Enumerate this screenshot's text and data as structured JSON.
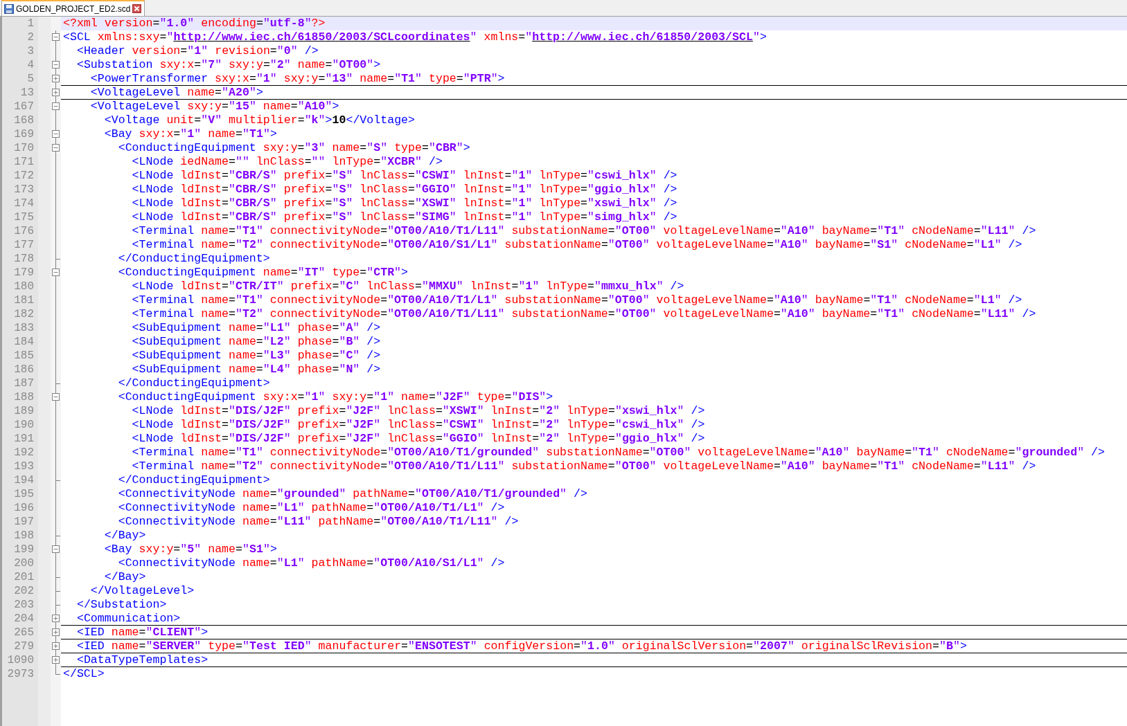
{
  "tab": {
    "title": "GOLDEN_PROJECT_ED2.scd",
    "selected": true
  },
  "lines": [
    {
      "number": "1",
      "kind": "plain",
      "current": true,
      "code": "<?xml version=\"1.0\" encoding=\"utf-8\"?>"
    },
    {
      "number": "2",
      "kind": "fold-open",
      "current": false,
      "code": "<SCL xmlns:sxy=\"http://www.iec.ch/61850/2003/SCLcoordinates\" xmlns=\"http://www.iec.ch/61850/2003/SCL\">"
    },
    {
      "number": "3",
      "kind": "plain",
      "current": false,
      "code": "  <Header version=\"1\" revision=\"0\" />"
    },
    {
      "number": "4",
      "kind": "fold-open",
      "current": false,
      "code": "  <Substation sxy:x=\"7\" sxy:y=\"2\" name=\"OT00\">"
    },
    {
      "number": "5",
      "kind": "fold-closed",
      "current": false,
      "code": "    <PowerTransformer sxy:x=\"1\" sxy:y=\"13\" name=\"T1\" type=\"PTR\">"
    },
    {
      "number": "13",
      "kind": "fold-closed",
      "current": false,
      "code": "    <VoltageLevel name=\"A20\">"
    },
    {
      "number": "167",
      "kind": "fold-open",
      "current": false,
      "code": "    <VoltageLevel sxy:y=\"15\" name=\"A10\">"
    },
    {
      "number": "168",
      "kind": "plain",
      "current": false,
      "code": "      <Voltage unit=\"V\" multiplier=\"k\">10</Voltage>"
    },
    {
      "number": "169",
      "kind": "fold-open",
      "current": false,
      "code": "      <Bay sxy:x=\"1\" name=\"T1\">"
    },
    {
      "number": "170",
      "kind": "fold-open",
      "current": false,
      "code": "        <ConductingEquipment sxy:y=\"3\" name=\"S\" type=\"CBR\">"
    },
    {
      "number": "171",
      "kind": "plain",
      "current": false,
      "code": "          <LNode iedName=\"\" lnClass=\"\" lnType=\"XCBR\" />"
    },
    {
      "number": "172",
      "kind": "plain",
      "current": false,
      "code": "          <LNode ldInst=\"CBR/S\" prefix=\"S\" lnClass=\"CSWI\" lnInst=\"1\" lnType=\"cswi_hlx\" />"
    },
    {
      "number": "173",
      "kind": "plain",
      "current": false,
      "code": "          <LNode ldInst=\"CBR/S\" prefix=\"S\" lnClass=\"GGIO\" lnInst=\"1\" lnType=\"ggio_hlx\" />"
    },
    {
      "number": "174",
      "kind": "plain",
      "current": false,
      "code": "          <LNode ldInst=\"CBR/S\" prefix=\"S\" lnClass=\"XSWI\" lnInst=\"1\" lnType=\"xswi_hlx\" />"
    },
    {
      "number": "175",
      "kind": "plain",
      "current": false,
      "code": "          <LNode ldInst=\"CBR/S\" prefix=\"S\" lnClass=\"SIMG\" lnInst=\"1\" lnType=\"simg_hlx\" />"
    },
    {
      "number": "176",
      "kind": "plain",
      "current": false,
      "code": "          <Terminal name=\"T1\" connectivityNode=\"OT00/A10/T1/L11\" substationName=\"OT00\" voltageLevelName=\"A10\" bayName=\"T1\" cNodeName=\"L11\" />"
    },
    {
      "number": "177",
      "kind": "plain",
      "current": false,
      "code": "          <Terminal name=\"T2\" connectivityNode=\"OT00/A10/S1/L1\" substationName=\"OT00\" voltageLevelName=\"A10\" bayName=\"S1\" cNodeName=\"L1\" />"
    },
    {
      "number": "178",
      "kind": "fold-end",
      "current": false,
      "code": "        </ConductingEquipment>"
    },
    {
      "number": "179",
      "kind": "fold-open",
      "current": false,
      "code": "        <ConductingEquipment name=\"IT\" type=\"CTR\">"
    },
    {
      "number": "180",
      "kind": "plain",
      "current": false,
      "code": "          <LNode ldInst=\"CTR/IT\" prefix=\"C\" lnClass=\"MMXU\" lnInst=\"1\" lnType=\"mmxu_hlx\" />"
    },
    {
      "number": "181",
      "kind": "plain",
      "current": false,
      "code": "          <Terminal name=\"T1\" connectivityNode=\"OT00/A10/T1/L1\" substationName=\"OT00\" voltageLevelName=\"A10\" bayName=\"T1\" cNodeName=\"L1\" />"
    },
    {
      "number": "182",
      "kind": "plain",
      "current": false,
      "code": "          <Terminal name=\"T2\" connectivityNode=\"OT00/A10/T1/L11\" substationName=\"OT00\" voltageLevelName=\"A10\" bayName=\"T1\" cNodeName=\"L11\" />"
    },
    {
      "number": "183",
      "kind": "plain",
      "current": false,
      "code": "          <SubEquipment name=\"L1\" phase=\"A\" />"
    },
    {
      "number": "184",
      "kind": "plain",
      "current": false,
      "code": "          <SubEquipment name=\"L2\" phase=\"B\" />"
    },
    {
      "number": "185",
      "kind": "plain",
      "current": false,
      "code": "          <SubEquipment name=\"L3\" phase=\"C\" />"
    },
    {
      "number": "186",
      "kind": "plain",
      "current": false,
      "code": "          <SubEquipment name=\"L4\" phase=\"N\" />"
    },
    {
      "number": "187",
      "kind": "fold-end",
      "current": false,
      "code": "        </ConductingEquipment>"
    },
    {
      "number": "188",
      "kind": "fold-open",
      "current": false,
      "code": "        <ConductingEquipment sxy:x=\"1\" sxy:y=\"1\" name=\"J2F\" type=\"DIS\">"
    },
    {
      "number": "189",
      "kind": "plain",
      "current": false,
      "code": "          <LNode ldInst=\"DIS/J2F\" prefix=\"J2F\" lnClass=\"XSWI\" lnInst=\"2\" lnType=\"xswi_hlx\" />"
    },
    {
      "number": "190",
      "kind": "plain",
      "current": false,
      "code": "          <LNode ldInst=\"DIS/J2F\" prefix=\"J2F\" lnClass=\"CSWI\" lnInst=\"2\" lnType=\"cswi_hlx\" />"
    },
    {
      "number": "191",
      "kind": "plain",
      "current": false,
      "code": "          <LNode ldInst=\"DIS/J2F\" prefix=\"J2F\" lnClass=\"GGIO\" lnInst=\"2\" lnType=\"ggio_hlx\" />"
    },
    {
      "number": "192",
      "kind": "plain",
      "current": false,
      "code": "          <Terminal name=\"T1\" connectivityNode=\"OT00/A10/T1/grounded\" substationName=\"OT00\" voltageLevelName=\"A10\" bayName=\"T1\" cNodeName=\"grounded\" />"
    },
    {
      "number": "193",
      "kind": "plain",
      "current": false,
      "code": "          <Terminal name=\"T2\" connectivityNode=\"OT00/A10/T1/L11\" substationName=\"OT00\" voltageLevelName=\"A10\" bayName=\"T1\" cNodeName=\"L11\" />"
    },
    {
      "number": "194",
      "kind": "fold-end",
      "current": false,
      "code": "        </ConductingEquipment>"
    },
    {
      "number": "195",
      "kind": "plain",
      "current": false,
      "code": "        <ConnectivityNode name=\"grounded\" pathName=\"OT00/A10/T1/grounded\" />"
    },
    {
      "number": "196",
      "kind": "plain",
      "current": false,
      "code": "        <ConnectivityNode name=\"L1\" pathName=\"OT00/A10/T1/L1\" />"
    },
    {
      "number": "197",
      "kind": "plain",
      "current": false,
      "code": "        <ConnectivityNode name=\"L11\" pathName=\"OT00/A10/T1/L11\" />"
    },
    {
      "number": "198",
      "kind": "fold-end",
      "current": false,
      "code": "      </Bay>"
    },
    {
      "number": "199",
      "kind": "fold-open",
      "current": false,
      "code": "      <Bay sxy:y=\"5\" name=\"S1\">"
    },
    {
      "number": "200",
      "kind": "plain",
      "current": false,
      "code": "        <ConnectivityNode name=\"L1\" pathName=\"OT00/A10/S1/L1\" />"
    },
    {
      "number": "201",
      "kind": "fold-end",
      "current": false,
      "code": "      </Bay>"
    },
    {
      "number": "202",
      "kind": "fold-end",
      "current": false,
      "code": "    </VoltageLevel>"
    },
    {
      "number": "203",
      "kind": "fold-end",
      "current": false,
      "code": "  </Substation>"
    },
    {
      "number": "204",
      "kind": "fold-closed",
      "current": false,
      "code": "  <Communication>"
    },
    {
      "number": "265",
      "kind": "fold-closed",
      "current": false,
      "code": "  <IED name=\"CLIENT\">"
    },
    {
      "number": "279",
      "kind": "fold-closed",
      "current": false,
      "code": "  <IED name=\"SERVER\" type=\"Test IED\" manufacturer=\"ENSOTEST\" configVersion=\"1.0\" originalSclVersion=\"2007\" originalSclRevision=\"B\">"
    },
    {
      "number": "1090",
      "kind": "fold-closed",
      "current": false,
      "code": "  <DataTypeTemplates>"
    },
    {
      "number": "2973",
      "kind": "fold-end",
      "current": false,
      "code": "</SCL>"
    }
  ]
}
